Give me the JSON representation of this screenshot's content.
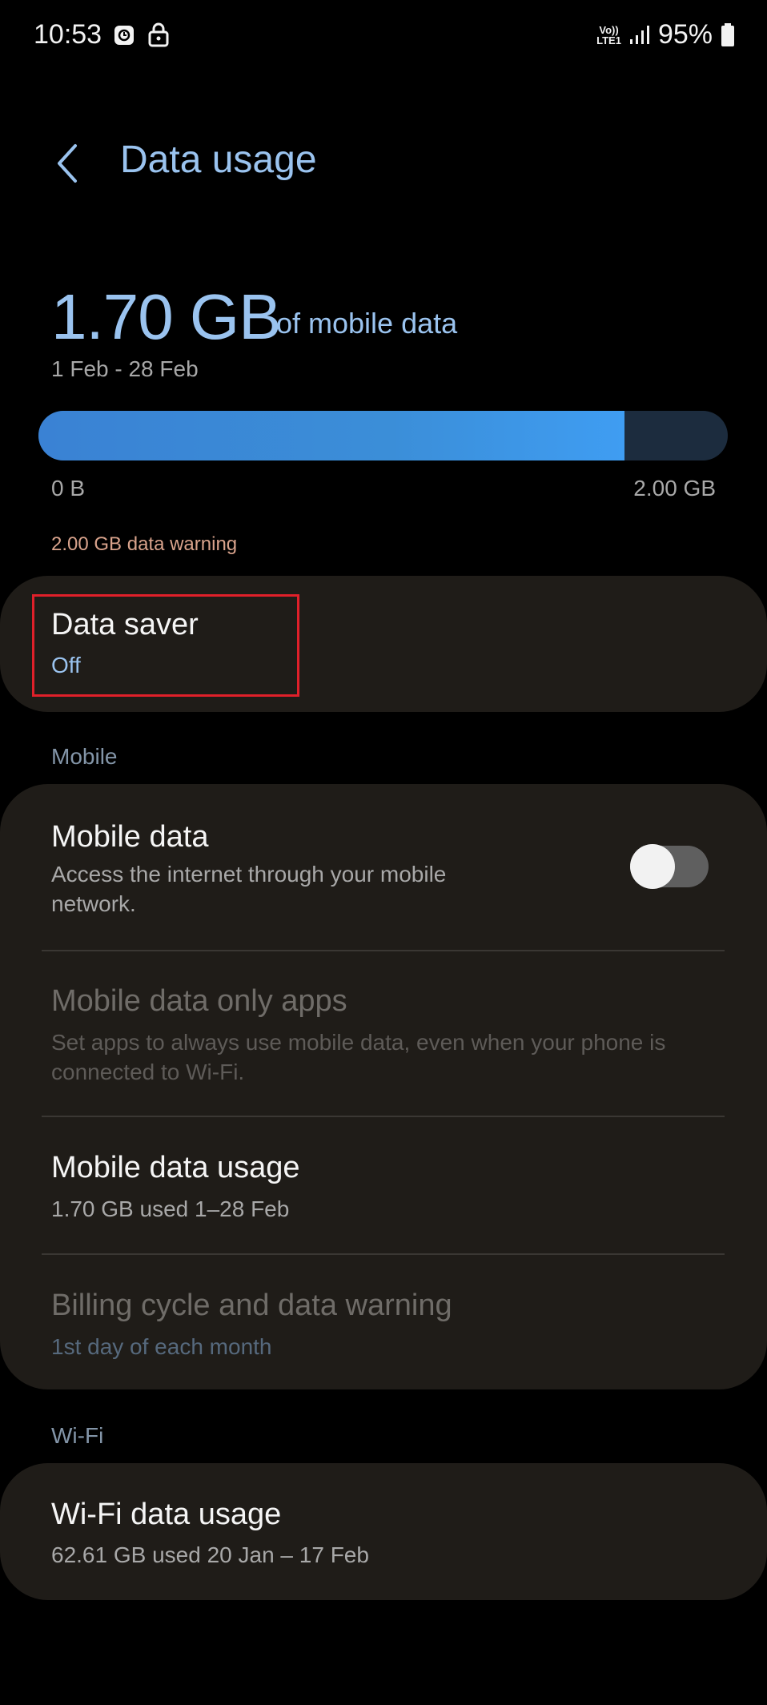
{
  "status_bar": {
    "time": "10:53",
    "network_label_top": "Vo))",
    "network_label_bottom": "LTE1",
    "battery": "95%"
  },
  "header": {
    "back_icon": "chevron-left-icon",
    "title": "Data usage"
  },
  "usage": {
    "amount": "1.70 GB",
    "suffix": "of mobile data",
    "period": "1 Feb - 28 Feb",
    "progress_fraction": 0.85,
    "min_label": "0 B",
    "max_label": "2.00 GB",
    "warning": "2.00 GB data warning"
  },
  "data_saver": {
    "title": "Data saver",
    "status": "Off"
  },
  "mobile_section": {
    "label": "Mobile",
    "mobile_data": {
      "title": "Mobile data",
      "description": "Access the internet through your mobile network.",
      "enabled": false
    },
    "mobile_data_only_apps": {
      "title": "Mobile data only apps",
      "description": "Set apps to always use mobile data, even when your phone is connected to Wi-Fi."
    },
    "mobile_data_usage": {
      "title": "Mobile data usage",
      "description": "1.70 GB used 1–28 Feb"
    },
    "billing_cycle": {
      "title": "Billing cycle and data warning",
      "description": "1st day of each month"
    }
  },
  "wifi_section": {
    "label": "Wi-Fi",
    "wifi_data_usage": {
      "title": "Wi-Fi data usage",
      "description": "62.61 GB used 20 Jan – 17 Feb"
    }
  },
  "colors": {
    "accent": "#9ac3ef",
    "progress": "#3f9df2",
    "warning": "#d9a38c",
    "highlight": "#e0202a",
    "card": "#1f1c18"
  }
}
